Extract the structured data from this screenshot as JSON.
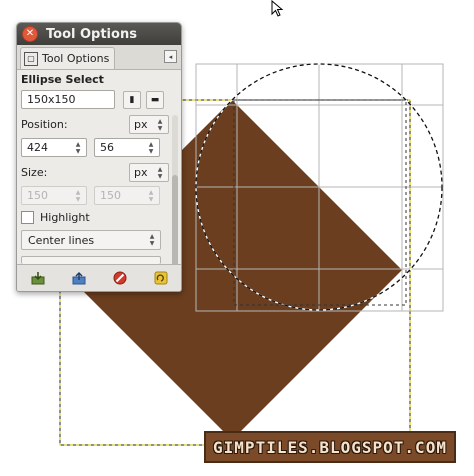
{
  "window": {
    "title": "Tool Options"
  },
  "tabs": [
    {
      "label": "Tool Options"
    }
  ],
  "tool": {
    "name": "Ellipse Select",
    "preset_value": "150x150",
    "position_label": "Position:",
    "position_unit": "px",
    "position_x": "424",
    "position_y": "56",
    "size_label": "Size:",
    "size_unit": "px",
    "size_w": "150",
    "size_h": "150",
    "highlight_label": "Highlight",
    "highlight_checked": false,
    "guides_value": "Center lines"
  },
  "bottom_icons": [
    "save-icon",
    "restore-icon",
    "delete-icon",
    "reset-icon"
  ],
  "watermark": "GIMPTILES.BLOGSPOT.COM",
  "colors": {
    "diamond": "#6b3e1f",
    "titlebar": "#4a4945",
    "close": "#e0593b"
  }
}
